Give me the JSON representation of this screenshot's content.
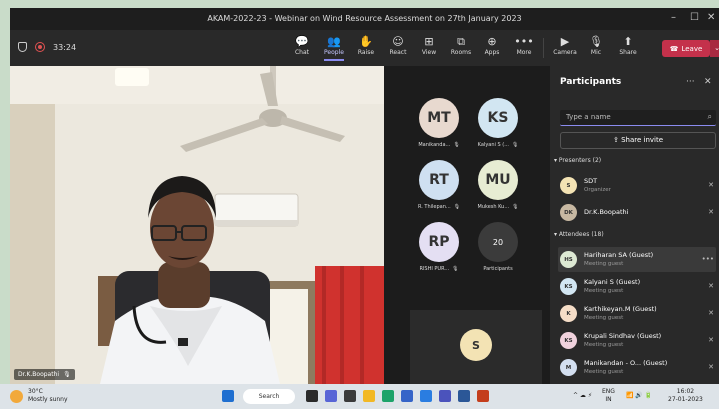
{
  "window": {
    "title": "AKAM-2022-23 - Webinar on Wind Resource Assessment on 27th January 2023",
    "minimize": "–",
    "maximize": "☐",
    "close": "✕"
  },
  "toolbar": {
    "timer": "33:24",
    "buttons": [
      {
        "label": "Chat",
        "icon": "💬"
      },
      {
        "label": "People",
        "icon": "👥"
      },
      {
        "label": "Raise",
        "icon": "✋"
      },
      {
        "label": "React",
        "icon": "☺"
      },
      {
        "label": "View",
        "icon": "⊞"
      },
      {
        "label": "Rooms",
        "icon": "⧉"
      },
      {
        "label": "Apps",
        "icon": "⊕"
      },
      {
        "label": "More",
        "icon": "•••"
      },
      {
        "label": "Camera",
        "icon": "▶"
      },
      {
        "label": "Mic",
        "icon": "🎙"
      },
      {
        "label": "Share",
        "icon": "⬆"
      }
    ],
    "leave_label": "Leave",
    "leave_icon": "☎",
    "leave_drop": "⌄",
    "accent_color": "#8b8cf0",
    "leave_color": "#c4314b"
  },
  "video": {
    "name": "Dr.K.Boopathi",
    "mic_icon": "🎙"
  },
  "tiles": [
    {
      "initials": "MT",
      "name": "Manikanda...",
      "color": "#e8d9cf"
    },
    {
      "initials": "KS",
      "name": "Kalyani S (...",
      "color": "#d2e6f2"
    },
    {
      "initials": "RT",
      "name": "R. Thilepan...",
      "color": "#cfe0f1"
    },
    {
      "initials": "MU",
      "name": "Mukesh Ku...",
      "color": "#e7ecd3"
    },
    {
      "initials": "RP",
      "name": "RISHI PUR...",
      "color": "#e4dff3"
    },
    {
      "initials": "20",
      "name": "Participants",
      "color": "#3b3b3b"
    }
  ],
  "my_tile": {
    "initials": "S",
    "color": "#f3e3b4"
  },
  "panel": {
    "title": "Participants",
    "more": "···",
    "close": "✕",
    "search_placeholder": "Type a name",
    "search_icon": "⌕",
    "share_invite": "Share invite",
    "share_icon": "⇪",
    "presenters_header": "▾ Presenters (2)",
    "attendees_header": "▾ Attendees (18)",
    "presenters": [
      {
        "initials": "S",
        "name": "SDT",
        "role": "Organizer",
        "color": "#f3e3b4"
      },
      {
        "initials": "DK",
        "name": "Dr.K.Boopathi",
        "role": "",
        "color": "#c7b8a2"
      }
    ],
    "attendees": [
      {
        "initials": "HS",
        "name": "Hariharan SA (Guest)",
        "role": "Meeting guest",
        "color": "#dde9d3",
        "extra": "•••"
      },
      {
        "initials": "KS",
        "name": "Kalyani S (Guest)",
        "role": "Meeting guest",
        "color": "#d2e6f2",
        "extra": ""
      },
      {
        "initials": "K",
        "name": "Karthikeyan.M (Guest)",
        "role": "Meeting guest",
        "color": "#f5ddc7",
        "extra": ""
      },
      {
        "initials": "KS",
        "name": "Krupali Sindhav (Guest)",
        "role": "Meeting guest",
        "color": "#f0d2dd",
        "extra": ""
      },
      {
        "initials": "M",
        "name": "Manikandan - O... (Guest)",
        "role": "Meeting guest",
        "color": "#d3dff0",
        "extra": ""
      }
    ],
    "mic_off_icon": "🎙̸"
  },
  "taskbar": {
    "temp": "30°C",
    "weather": "Mostly sunny",
    "search_label": "Search",
    "lang_top": "ENG",
    "lang_bottom": "IN",
    "time": "16:02",
    "date": "27-01-2023",
    "tray_icons": "^ ☁ ⚡",
    "net_icons": "📶 🔊 🔋"
  }
}
